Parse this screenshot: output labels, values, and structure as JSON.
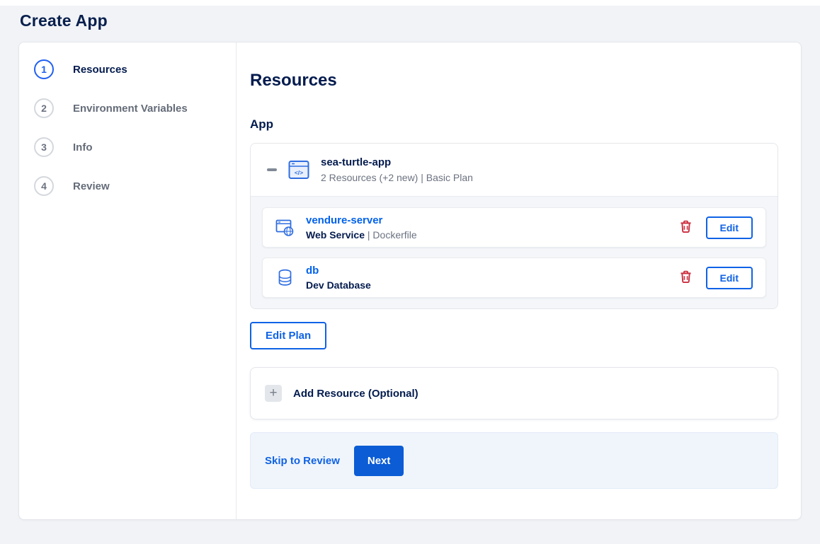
{
  "page": {
    "title": "Create App"
  },
  "steps": [
    {
      "number": "1",
      "label": "Resources",
      "active": true
    },
    {
      "number": "2",
      "label": "Environment Variables",
      "active": false
    },
    {
      "number": "3",
      "label": "Info",
      "active": false
    },
    {
      "number": "4",
      "label": "Review",
      "active": false
    }
  ],
  "main": {
    "heading": "Resources",
    "section_label": "App",
    "app_card": {
      "collapse_icon": "minus-icon",
      "app_icon": "app-window-code-icon",
      "name": "sea-turtle-app",
      "summary": "2 Resources (+2 new) | Basic Plan",
      "resources": [
        {
          "icon": "web-service-icon",
          "name": "vendure-server",
          "subtitle_bold": "Web Service",
          "subtitle_rest": " | Dockerfile",
          "delete_icon": "trash-icon",
          "edit_label": "Edit"
        },
        {
          "icon": "database-icon",
          "name": "db",
          "subtitle_bold": "Dev Database",
          "subtitle_rest": "",
          "delete_icon": "trash-icon",
          "edit_label": "Edit"
        }
      ]
    },
    "edit_plan_label": "Edit Plan",
    "add_resource": {
      "icon": "plus-icon",
      "label": "Add Resource (Optional)"
    },
    "footer": {
      "skip_label": "Skip to Review",
      "next_label": "Next"
    }
  },
  "colors": {
    "accent_blue": "#0061eb",
    "navy_text": "#031b4e",
    "muted_text": "#6b7280",
    "danger_red": "#cb2e3e",
    "page_background": "#f1f3f6",
    "footer_background": "#f0f5fb"
  }
}
